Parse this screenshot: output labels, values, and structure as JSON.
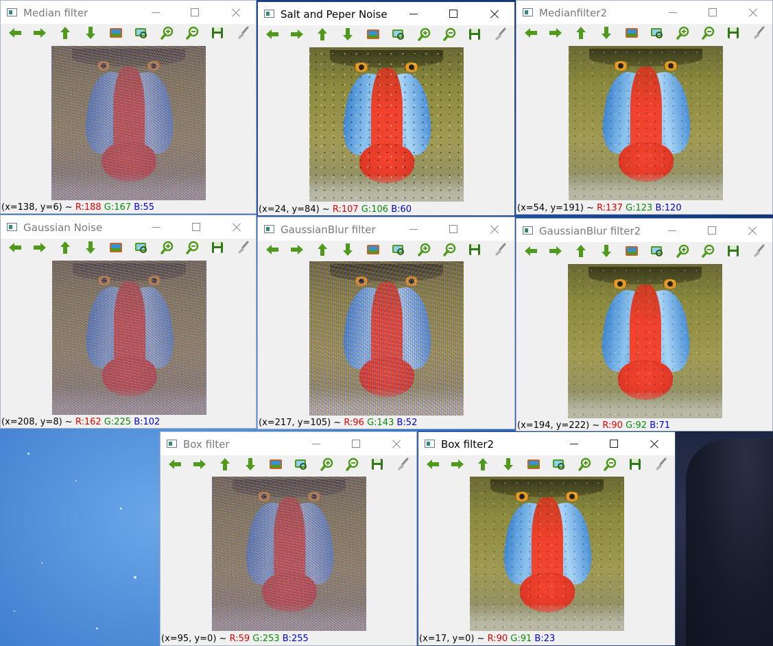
{
  "colors": {
    "arrow_green": "#4f9a1c",
    "status_red": "#e00000",
    "status_green": "#0a8a0a",
    "status_blue": "#0000d0"
  },
  "toolbar_icons": [
    "pan-left-icon",
    "pan-right-icon",
    "pan-up-icon",
    "pan-down-icon",
    "zoom-to-fit-icon",
    "zoom-to-region-icon",
    "zoom-in-icon",
    "zoom-out-icon",
    "save-icon",
    "properties-brush-icon"
  ],
  "windows": [
    {
      "id": "median",
      "title": "Median filter",
      "status": {
        "coords": "(x=138, y=6) ~ ",
        "r": "R:188",
        "g": "G:167",
        "b": "B:55"
      }
    },
    {
      "id": "saltpepper",
      "title": "Salt and Peper Noise",
      "status": {
        "coords": "(x=24, y=84) ~ ",
        "r": "R:107",
        "g": "G:106",
        "b": "B:60"
      }
    },
    {
      "id": "median2",
      "title": "Medianfilter2",
      "status": {
        "coords": "(x=54, y=191) ~ ",
        "r": "R:137",
        "g": "G:123",
        "b": "B:120"
      }
    },
    {
      "id": "gaussnoise",
      "title": "Gaussian Noise",
      "status": {
        "coords": "(x=208, y=8) ~ ",
        "r": "R:162",
        "g": "G:225",
        "b": "B:102"
      }
    },
    {
      "id": "gaussblur",
      "title": "GaussianBlur filter",
      "status": {
        "coords": "(x=217, y=105) ~ ",
        "r": "R:96",
        "g": "G:143",
        "b": "B:52"
      }
    },
    {
      "id": "gaussblur2",
      "title": "GaussianBlur filter2",
      "status": {
        "coords": "(x=194, y=222) ~ ",
        "r": "R:90",
        "g": "G:92",
        "b": "B:71"
      }
    },
    {
      "id": "box",
      "title": "Box filter",
      "status": {
        "coords": "(x=95, y=0) ~ ",
        "r": "R:59",
        "g": "G:253",
        "b": "B:255"
      }
    },
    {
      "id": "box2",
      "title": "Box filter2",
      "status": {
        "coords": "(x=17, y=0) ~ ",
        "r": "R:90",
        "g": "G:91",
        "b": "B:23"
      }
    }
  ]
}
